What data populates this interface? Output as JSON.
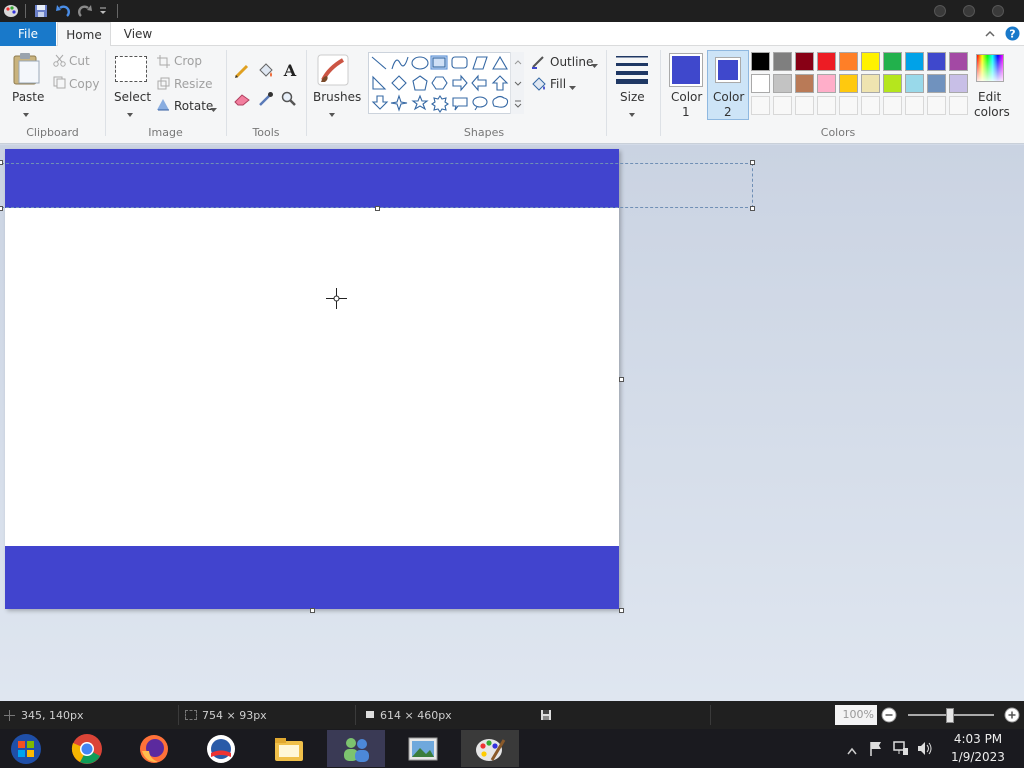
{
  "tabs": {
    "file": "File",
    "home": "Home",
    "view": "View"
  },
  "clipboard": {
    "paste": "Paste",
    "cut": "Cut",
    "copy": "Copy",
    "group": "Clipboard"
  },
  "image": {
    "select": "Select",
    "crop": "Crop",
    "resize": "Resize",
    "rotate": "Rotate",
    "group": "Image"
  },
  "tools": {
    "group": "Tools"
  },
  "brushes": {
    "label": "Brushes"
  },
  "shapes": {
    "outline": "Outline",
    "fill": "Fill",
    "group": "Shapes"
  },
  "size": {
    "label": "Size"
  },
  "colors": {
    "color1_line1": "Color",
    "color1_line2": "1",
    "color2_line1": "Color",
    "color2_line2": "2",
    "edit_line1": "Edit",
    "edit_line2": "colors",
    "group": "Colors",
    "color1_value": "#3f48cc",
    "color2_value": "#3f48cc",
    "palette_row1": [
      "#000000",
      "#7f7f7f",
      "#880015",
      "#ed1c24",
      "#ff7f27",
      "#fff200",
      "#22b14c",
      "#00a2e8",
      "#3f48cc",
      "#a349a4"
    ],
    "palette_row2": [
      "#ffffff",
      "#c3c3c3",
      "#b97a57",
      "#ffaec9",
      "#ffc90e",
      "#efe4b0",
      "#b5e61d",
      "#99d9ea",
      "#7092be",
      "#c8bfe7"
    ]
  },
  "canvas": {
    "band_color": "#4144ce"
  },
  "status": {
    "cursor_pos": "345, 140px",
    "selection_size": "754 × 93px",
    "image_size": "614 × 460px",
    "zoom": "100%"
  },
  "clock": {
    "time": "4:03 PM",
    "date": "1/9/2023"
  }
}
